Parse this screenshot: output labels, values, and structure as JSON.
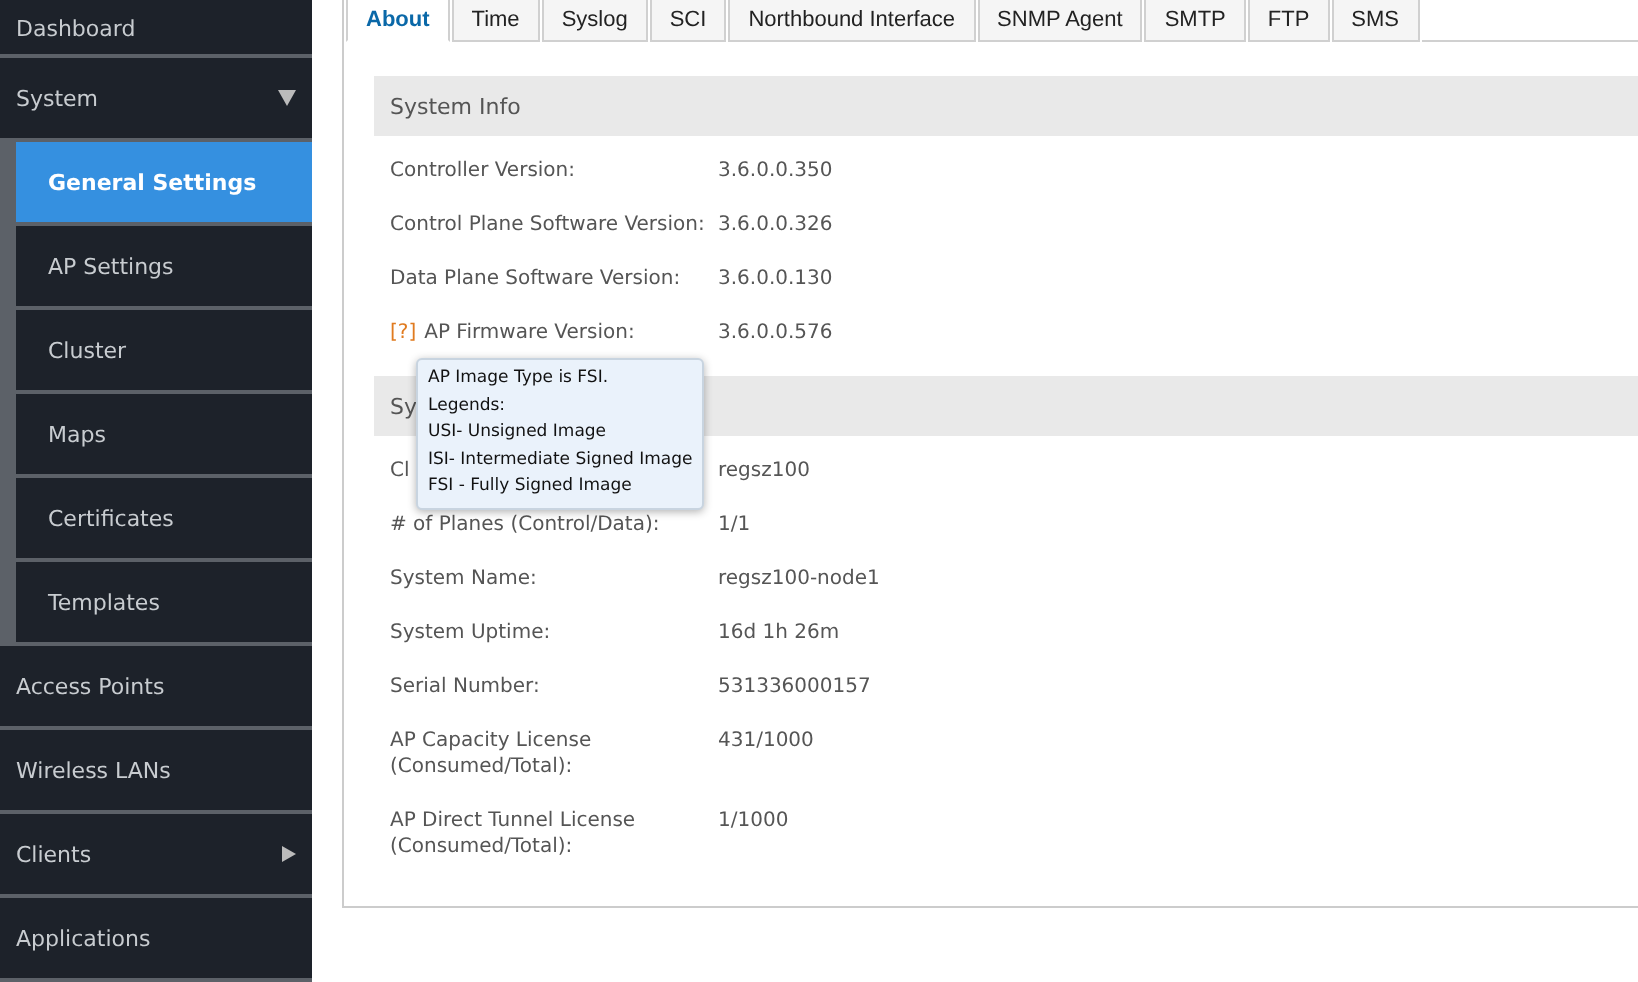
{
  "sidebar": {
    "items": [
      {
        "label": "Dashboard"
      },
      {
        "label": "System",
        "expanded": true,
        "children": [
          {
            "label": "General Settings",
            "selected": true
          },
          {
            "label": "AP Settings",
            "selected": false
          },
          {
            "label": "Cluster",
            "selected": false
          },
          {
            "label": "Maps",
            "selected": false
          },
          {
            "label": "Certificates",
            "selected": false
          },
          {
            "label": "Templates",
            "selected": false
          }
        ]
      },
      {
        "label": "Access Points"
      },
      {
        "label": "Wireless LANs"
      },
      {
        "label": "Clients",
        "expanded": false
      },
      {
        "label": "Applications"
      }
    ]
  },
  "tabs": [
    {
      "label": "About",
      "selected": true
    },
    {
      "label": "Time",
      "selected": false
    },
    {
      "label": "Syslog",
      "selected": false
    },
    {
      "label": "SCI",
      "selected": false
    },
    {
      "label": "Northbound Interface",
      "selected": false
    },
    {
      "label": "SNMP Agent",
      "selected": false
    },
    {
      "label": "SMTP",
      "selected": false
    },
    {
      "label": "FTP",
      "selected": false
    },
    {
      "label": "SMS",
      "selected": false
    }
  ],
  "sections": [
    {
      "title": "System Info",
      "rows": [
        {
          "label": "Controller Version:",
          "value": "3.6.0.0.350"
        },
        {
          "label": "Control Plane Software Version:",
          "value": "3.6.0.0.326"
        },
        {
          "label": "Data Plane Software Version:",
          "value": "3.6.0.0.130"
        },
        {
          "help": "[?]",
          "label": "AP Firmware Version:",
          "value": "3.6.0.0.576"
        }
      ]
    },
    {
      "title": "Sy",
      "rows": [
        {
          "label": "Cl",
          "value": "regsz100"
        },
        {
          "label": "# of Planes (Control/Data):",
          "value": "1/1"
        },
        {
          "label": "System Name:",
          "value": "regsz100-node1"
        },
        {
          "label": "System Uptime:",
          "value": "16d 1h 26m"
        },
        {
          "label": "Serial Number:",
          "value": "531336000157"
        },
        {
          "label": "AP Capacity License (Consumed/Total):",
          "value": "431/1000"
        },
        {
          "label": "AP Direct Tunnel License (Consumed/Total):",
          "value": "1/1000"
        }
      ]
    }
  ],
  "tooltip": {
    "lines": [
      "AP Image Type is FSI.",
      "Legends:",
      "USI- Unsigned Image",
      "ISI- Intermediate Signed Image",
      "FSI - Fully Signed Image"
    ]
  }
}
